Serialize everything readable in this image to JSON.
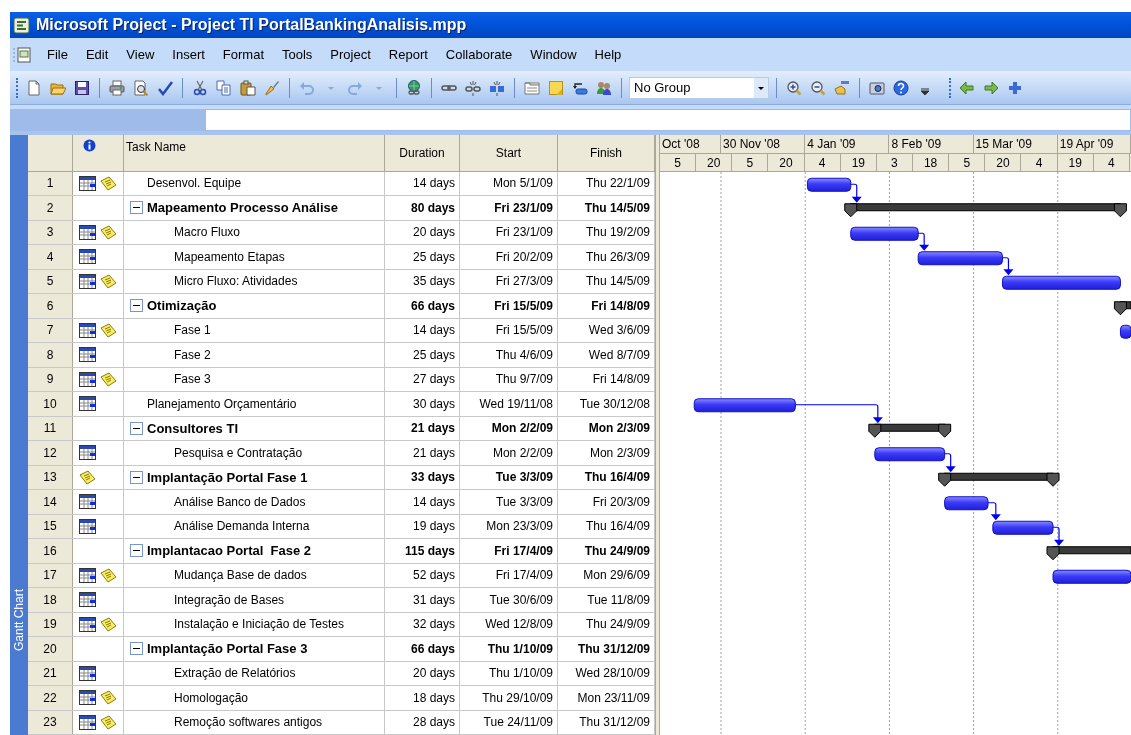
{
  "window": {
    "title": "Microsoft Project - Project TI PortalBankingAnalisis.mpp"
  },
  "menu": [
    "File",
    "Edit",
    "View",
    "Insert",
    "Format",
    "Tools",
    "Project",
    "Report",
    "Collaborate",
    "Window",
    "Help"
  ],
  "toolbar": {
    "group_field": {
      "value": "No Group"
    }
  },
  "view_bar": {
    "label": "Gantt Chart"
  },
  "table": {
    "columns": [
      "Task Name",
      "Duration",
      "Start",
      "Finish"
    ]
  },
  "timescale": {
    "major": [
      "Oct '08",
      "30 Nov '08",
      "4 Jan '09",
      "8 Feb '09",
      "15 Mar '09",
      "19 Apr '09"
    ],
    "minor": [
      "5",
      "20",
      "5",
      "20",
      "4",
      "19",
      "3",
      "18",
      "5",
      "20",
      "4",
      "19",
      "4"
    ]
  },
  "tasks": [
    {
      "row": "1",
      "calendar": true,
      "note": true,
      "name": "Desenvol. Equipe",
      "duration": "14 days",
      "start": "Mon 5/1/09",
      "finish": "Thu 22/1/09"
    },
    {
      "row": "2",
      "calendar": false,
      "note": false,
      "name": "Mapeamento Processo Análise",
      "duration": "80 days",
      "start": "Fri 23/1/09",
      "finish": "Thu 14/5/09",
      "expanded": true,
      "children": [
        {
          "row": "3",
          "calendar": true,
          "note": true,
          "name": "Macro Fluxo",
          "duration": "20 days",
          "start": "Fri 23/1/09",
          "finish": "Thu 19/2/09"
        },
        {
          "row": "4",
          "calendar": true,
          "note": false,
          "name": "Mapeamento Etapas",
          "duration": "25 days",
          "start": "Fri 20/2/09",
          "finish": "Thu 26/3/09"
        },
        {
          "row": "5",
          "calendar": true,
          "note": true,
          "name": "Micro Fluxo: Atividades",
          "duration": "35 days",
          "start": "Fri 27/3/09",
          "finish": "Thu 14/5/09"
        }
      ]
    },
    {
      "row": "6",
      "calendar": false,
      "note": false,
      "name": "Otimização",
      "duration": "66 days",
      "start": "Fri 15/5/09",
      "finish": "Fri 14/8/09",
      "expanded": true,
      "children": [
        {
          "row": "7",
          "calendar": true,
          "note": true,
          "name": "Fase 1",
          "duration": "14 days",
          "start": "Fri 15/5/09",
          "finish": "Wed 3/6/09"
        },
        {
          "row": "8",
          "calendar": true,
          "note": false,
          "name": "Fase 2",
          "duration": "25 days",
          "start": "Thu 4/6/09",
          "finish": "Wed 8/7/09"
        },
        {
          "row": "9",
          "calendar": true,
          "note": true,
          "name": "Fase 3",
          "duration": "27 days",
          "start": "Thu 9/7/09",
          "finish": "Fri 14/8/09"
        }
      ]
    },
    {
      "row": "10",
      "calendar": true,
      "note": false,
      "name": "Planejamento Orçamentário",
      "duration": "30 days",
      "start": "Wed 19/11/08",
      "finish": "Tue 30/12/08"
    },
    {
      "row": "11",
      "calendar": false,
      "note": false,
      "name": "Consultores TI",
      "duration": "21 days",
      "start": "Mon 2/2/09",
      "finish": "Mon 2/3/09",
      "expanded": true,
      "children": [
        {
          "row": "12",
          "calendar": true,
          "note": false,
          "name": "Pesquisa e Contratação",
          "duration": "21 days",
          "start": "Mon 2/2/09",
          "finish": "Mon 2/3/09"
        }
      ]
    },
    {
      "row": "13",
      "calendar": false,
      "note": true,
      "name": "Implantação Portal Fase 1",
      "duration": "33 days",
      "start": "Tue 3/3/09",
      "finish": "Thu 16/4/09",
      "expanded": true,
      "children": [
        {
          "row": "14",
          "calendar": true,
          "note": false,
          "name": "Análise Banco de Dados",
          "duration": "14 days",
          "start": "Tue 3/3/09",
          "finish": "Fri 20/3/09"
        },
        {
          "row": "15",
          "calendar": true,
          "note": false,
          "name": "Análise Demanda Interna",
          "duration": "19 days",
          "start": "Mon 23/3/09",
          "finish": "Thu 16/4/09"
        }
      ]
    },
    {
      "row": "16",
      "calendar": false,
      "note": false,
      "name": "Implantacao Portal  Fase 2",
      "duration": "115 days",
      "start": "Fri 17/4/09",
      "finish": "Thu 24/9/09",
      "expanded": true,
      "children": [
        {
          "row": "17",
          "calendar": true,
          "note": true,
          "name": "Mudança Base de dados",
          "duration": "52 days",
          "start": "Fri 17/4/09",
          "finish": "Mon 29/6/09"
        },
        {
          "row": "18",
          "calendar": true,
          "note": false,
          "name": "Integração de Bases",
          "duration": "31 days",
          "start": "Tue 30/6/09",
          "finish": "Tue 11/8/09"
        },
        {
          "row": "19",
          "calendar": true,
          "note": true,
          "name": "Instalação e Iniciação de Testes",
          "duration": "32 days",
          "start": "Wed 12/8/09",
          "finish": "Thu 24/9/09"
        }
      ]
    },
    {
      "row": "20",
      "calendar": false,
      "note": false,
      "name": "Implantação Portal Fase 3",
      "duration": "66 days",
      "start": "Thu 1/10/09",
      "finish": "Thu 31/12/09",
      "expanded": true,
      "children": [
        {
          "row": "21",
          "calendar": true,
          "note": false,
          "name": "Extração de Relatórios",
          "duration": "20 days",
          "start": "Thu 1/10/09",
          "finish": "Wed 28/10/09"
        },
        {
          "row": "22",
          "calendar": true,
          "note": true,
          "name": "Homologação",
          "duration": "18 days",
          "start": "Thu 29/10/09",
          "finish": "Mon 23/11/09"
        },
        {
          "row": "23",
          "calendar": true,
          "note": true,
          "name": "Remoção softwares antigos",
          "duration": "28 days",
          "start": "Tue 24/11/09",
          "finish": "Thu 31/12/09"
        }
      ]
    }
  ]
}
